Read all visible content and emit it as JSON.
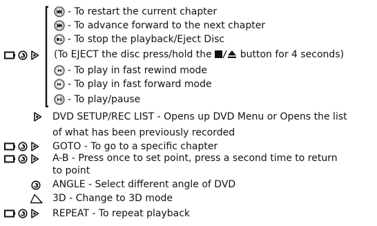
{
  "buttons": [
    {
      "icon": "restart-chapter-icon",
      "text": "- To restart the current chapter"
    },
    {
      "icon": "next-chapter-icon",
      "text": "- To advance forward to the next chapter"
    },
    {
      "icon": "stop-eject-icon",
      "text": "- To stop the playback/Eject Disc"
    }
  ],
  "eject_note": {
    "before": "(To EJECT the disc press/hold the ",
    "after": " button for 4 seconds)"
  },
  "buttons_lower": [
    {
      "icon": "fast-rewind-icon",
      "text": "- To play in fast rewind mode"
    },
    {
      "icon": "fast-forward-icon",
      "text": "- To play in fast forward mode"
    },
    {
      "icon": "play-pause-icon",
      "text": "- To play/pause"
    }
  ],
  "functions": {
    "setup_line1": "DVD SETUP/REC LIST - Opens up DVD Menu or Opens the list",
    "setup_line2": "of what has been previously recorded",
    "goto": "GOTO - To go to a specific chapter",
    "ab_line1": "A-B - Press once to set point, press a second time to return",
    "ab_line2": "to point",
    "angle": "ANGLE - Select different angle of DVD",
    "three_d": "3D - Change to 3D mode",
    "repeat": "REPEAT - To repeat playback"
  }
}
